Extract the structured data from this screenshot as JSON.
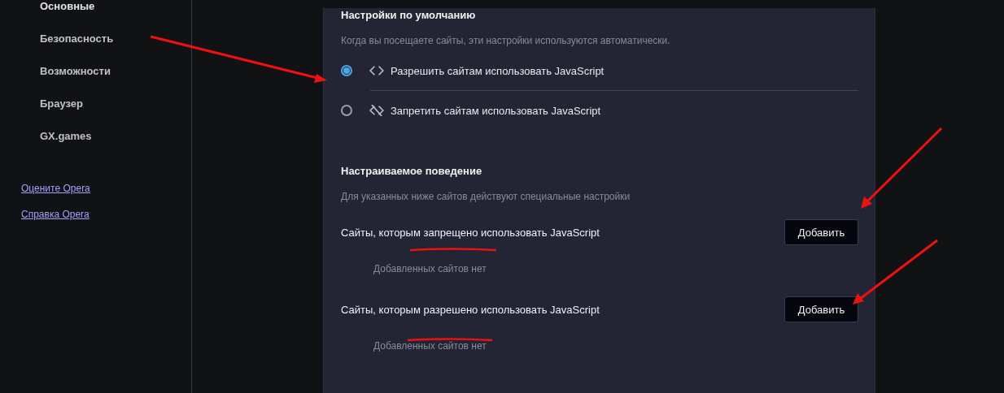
{
  "sidebar": {
    "items": [
      {
        "label": "Основные",
        "selected": true
      },
      {
        "label": "Безопасность",
        "selected": false
      },
      {
        "label": "Возможности",
        "selected": false
      },
      {
        "label": "Браузер",
        "selected": false
      },
      {
        "label": "GX.games",
        "selected": false
      }
    ],
    "links": [
      "Оцените Opera",
      "Справка Opera"
    ]
  },
  "default_settings": {
    "title": "Настройки по умолчанию",
    "description": "Когда вы посещаете сайты, эти настройки используются автоматически.",
    "options": [
      {
        "kind": "allow",
        "label": "Разрешить сайтам использовать JavaScript",
        "selected": true
      },
      {
        "kind": "block",
        "label": "Запретить сайтам использовать JavaScript",
        "selected": false
      }
    ]
  },
  "custom_behavior": {
    "title": "Настраиваемое поведение",
    "description": "Для указанных ниже сайтов действуют специальные настройки",
    "lists": [
      {
        "title": "Сайты, которым запрещено использовать JavaScript",
        "button": "Добавить",
        "empty_text": "Добавленных сайтов нет"
      },
      {
        "title": "Сайты, которым разрешено использовать JavaScript",
        "button": "Добавить",
        "empty_text": "Добавленных сайтов нет"
      }
    ]
  }
}
